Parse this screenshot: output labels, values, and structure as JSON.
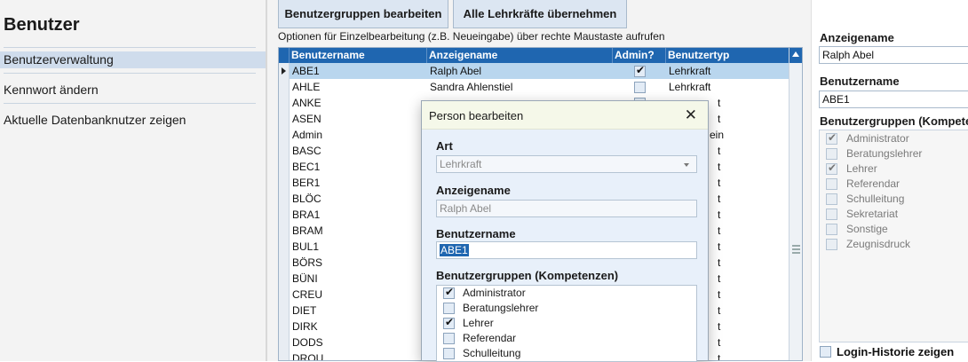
{
  "sidebar": {
    "title": "Benutzer",
    "items": [
      {
        "label": "Benutzerverwaltung",
        "active": true
      },
      {
        "label": "Kennwort ändern",
        "active": false
      },
      {
        "label": "Aktuelle Datenbanknutzer zeigen",
        "active": false
      }
    ]
  },
  "toolbar": {
    "edit_groups_label": "Benutzergruppen bearbeiten",
    "import_teachers_label": "Alle Lehrkräfte übernehmen"
  },
  "hint": "Optionen für Einzelbearbeitung (z.B. Neueingabe) über rechte Maustaste aufrufen",
  "grid": {
    "columns": [
      "Benutzername",
      "Anzeigename",
      "Admin?",
      "Benutzertyp"
    ],
    "rows": [
      {
        "user": "ABE1",
        "name": "Ralph Abel",
        "admin": true,
        "type": "Lehrkraft",
        "selected": true
      },
      {
        "user": "AHLE",
        "name": "Sandra Ahlenstiel",
        "admin": false,
        "type": "Lehrkraft"
      },
      {
        "user": "ANKE",
        "name": "",
        "admin": false,
        "type": ""
      },
      {
        "user": "ASEN",
        "name": "",
        "admin": false,
        "type": ""
      },
      {
        "user": "Admin",
        "name": "",
        "admin": false,
        "type": ""
      },
      {
        "user": "BASC",
        "name": "",
        "admin": false,
        "type": ""
      },
      {
        "user": "BEC1",
        "name": "",
        "admin": false,
        "type": ""
      },
      {
        "user": "BER1",
        "name": "",
        "admin": false,
        "type": ""
      },
      {
        "user": "BLÖC",
        "name": "",
        "admin": false,
        "type": ""
      },
      {
        "user": "BRA1",
        "name": "",
        "admin": false,
        "type": ""
      },
      {
        "user": "BRAM",
        "name": "",
        "admin": false,
        "type": ""
      },
      {
        "user": "BUL1",
        "name": "",
        "admin": false,
        "type": ""
      },
      {
        "user": "BÖRS",
        "name": "",
        "admin": false,
        "type": ""
      },
      {
        "user": "BÜNI",
        "name": "",
        "admin": false,
        "type": ""
      },
      {
        "user": "CREU",
        "name": "",
        "admin": false,
        "type": ""
      },
      {
        "user": "DIET",
        "name": "",
        "admin": false,
        "type": ""
      },
      {
        "user": "DIRK",
        "name": "",
        "admin": false,
        "type": ""
      },
      {
        "user": "DODS",
        "name": "",
        "admin": false,
        "type": ""
      },
      {
        "user": "DROU",
        "name": "",
        "admin": false,
        "type": ""
      }
    ],
    "partial_type_fragments": [
      "t",
      "t",
      "ein",
      "t",
      "t",
      "t",
      "t",
      "t",
      "t",
      "t",
      "t",
      "t",
      "t",
      "t",
      "t",
      "t",
      "t"
    ]
  },
  "detail": {
    "display_name_label": "Anzeigename",
    "display_name_value": "Ralph Abel",
    "username_label": "Benutzername",
    "username_value": "ABE1",
    "groups_label": "Benutzergruppen (Kompetenzen)",
    "groups": [
      {
        "label": "Administrator",
        "checked": true
      },
      {
        "label": "Beratungslehrer",
        "checked": false
      },
      {
        "label": "Lehrer",
        "checked": true
      },
      {
        "label": "Referendar",
        "checked": false
      },
      {
        "label": "Schulleitung",
        "checked": false
      },
      {
        "label": "Sekretariat",
        "checked": false
      },
      {
        "label": "Sonstige",
        "checked": false
      },
      {
        "label": "Zeugnisdruck",
        "checked": false
      }
    ],
    "login_history_label": "Login-Historie zeigen"
  },
  "dialog": {
    "title": "Person bearbeiten",
    "art_label": "Art",
    "art_value": "Lehrkraft",
    "display_name_label": "Anzeigename",
    "display_name_value": "Ralph Abel",
    "username_label": "Benutzername",
    "username_value": "ABE1",
    "groups_label": "Benutzergruppen (Kompetenzen)",
    "groups": [
      {
        "label": "Administrator",
        "checked": true
      },
      {
        "label": "Beratungslehrer",
        "checked": false
      },
      {
        "label": "Lehrer",
        "checked": true
      },
      {
        "label": "Referendar",
        "checked": false
      },
      {
        "label": "Schulleitung",
        "checked": false
      }
    ]
  }
}
